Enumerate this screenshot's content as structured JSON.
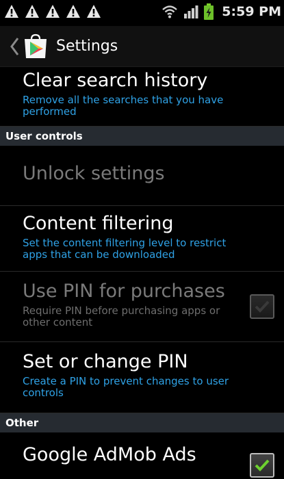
{
  "status_bar": {
    "time": "5:59 PM",
    "notification_icons": [
      "warning-icon",
      "warning-icon",
      "warning-icon",
      "warning-icon",
      "warning-icon"
    ],
    "wifi_icon": "wifi-icon",
    "signal_icon": "signal-icon",
    "battery_icon": "battery-charging-icon"
  },
  "action_bar": {
    "title": "Settings",
    "up_icon": "chevron-left-icon",
    "app_icon": "play-store-icon"
  },
  "items": {
    "clear_history": {
      "title": "Clear search history",
      "summary": "Remove all the searches that you have performed"
    },
    "user_controls_header": "User controls",
    "unlock_settings": {
      "title": "Unlock settings"
    },
    "content_filtering": {
      "title": "Content filtering",
      "summary": "Set the content filtering level to restrict apps that can be downloaded"
    },
    "use_pin": {
      "title": "Use PIN for purchases",
      "summary": "Require PIN before purchasing apps or other content",
      "checked": false
    },
    "set_pin": {
      "title": "Set or change PIN",
      "summary": "Create a PIN to prevent changes to user controls"
    },
    "other_header": "Other",
    "admob": {
      "title": "Google AdMob Ads",
      "checked": true
    }
  },
  "colors": {
    "summary_blue": "#2fa2e6",
    "category_bg": "#262b31",
    "disabled_text": "#7a7a7a",
    "check_green": "#6dd12f"
  }
}
